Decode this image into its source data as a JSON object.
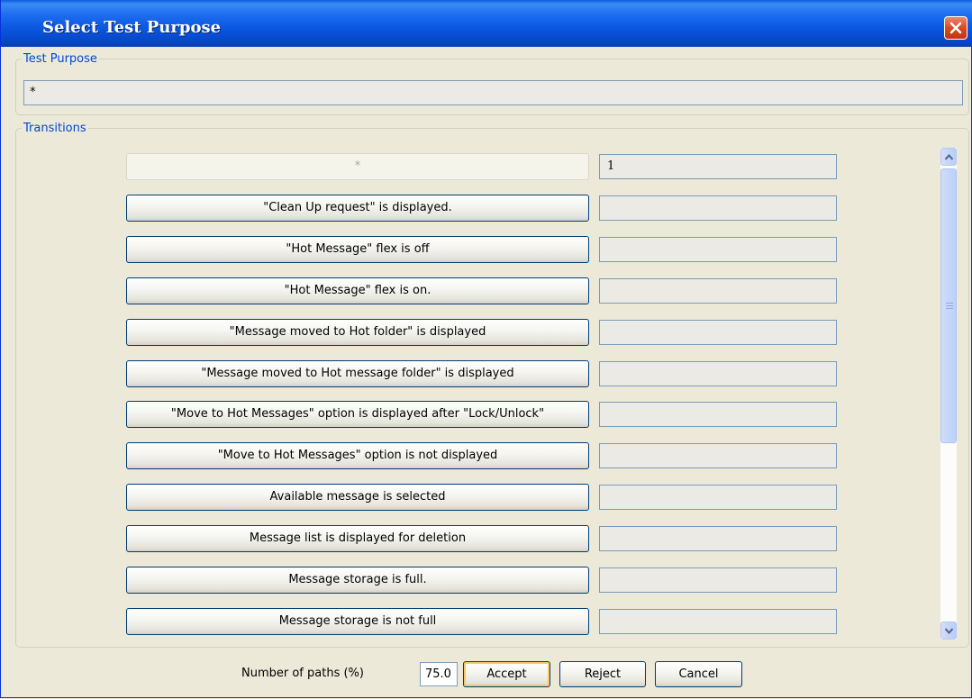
{
  "window": {
    "title": "Select Test Purpose"
  },
  "test_purpose": {
    "legend": "Test Purpose",
    "value": "*"
  },
  "transitions": {
    "legend": "Transitions",
    "rows": [
      {
        "label": "*",
        "value": "1",
        "enabled": false
      },
      {
        "label": "\"Clean Up request\" is displayed.",
        "value": ""
      },
      {
        "label": "\"Hot Message\" flex is off",
        "value": ""
      },
      {
        "label": "\"Hot Message\" flex is on.",
        "value": ""
      },
      {
        "label": "\"Message moved to Hot folder\" is displayed",
        "value": ""
      },
      {
        "label": "\"Message moved to Hot message folder\" is displayed",
        "value": ""
      },
      {
        "label": "\"Move to Hot Messages\" option is displayed after \"Lock/Unlock\"",
        "value": ""
      },
      {
        "label": "\"Move to Hot Messages\" option is not displayed",
        "value": ""
      },
      {
        "label": "Available message is selected",
        "value": ""
      },
      {
        "label": "Message list is displayed for deletion",
        "value": ""
      },
      {
        "label": "Message storage is full.",
        "value": ""
      },
      {
        "label": "Message storage is not full",
        "value": ""
      },
      {
        "label": "",
        "value": ""
      }
    ]
  },
  "footer": {
    "paths_label": "Number of paths (%)",
    "paths_value": "75.0",
    "accept_label": "Accept",
    "reject_label": "Reject",
    "cancel_label": "Cancel"
  },
  "colors": {
    "titlebar": "#0a57e0",
    "legend_text": "#0046d5",
    "dialog_bg": "#ece9d8",
    "close_button": "#d94a21"
  },
  "icons": [
    "close-icon",
    "scroll-up-arrow-icon",
    "scroll-down-arrow-icon"
  ]
}
